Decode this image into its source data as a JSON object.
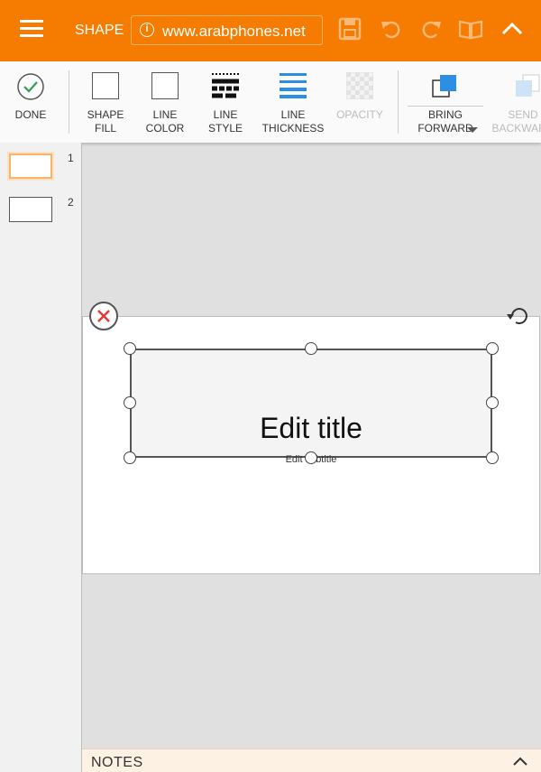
{
  "topbar": {
    "mode_label": "SHAPE",
    "url": "www.arabphones.net",
    "icons": [
      "menu-icon",
      "info-icon",
      "save-icon",
      "undo-icon",
      "redo-icon",
      "book-icon",
      "chevron-up-icon"
    ],
    "accent_color": "#f57c00"
  },
  "ribbon": {
    "done_label": "DONE",
    "shape_fill_label": "SHAPE\nFILL",
    "line_color_label": "LINE\nCOLOR",
    "line_style_label": "LINE\nSTYLE",
    "line_thickness_label": "LINE\nTHICKNESS",
    "opacity_label": "OPACITY",
    "bring_forward_label": "BRING\nFORWARD",
    "send_backward_label": "SEND\nBACKWARD"
  },
  "slides": {
    "thumbnails": [
      {
        "number": "1",
        "selected": true
      },
      {
        "number": "2",
        "selected": false
      }
    ]
  },
  "slide": {
    "title": "Edit title",
    "subtitle": "Edit subtitle"
  },
  "notes": {
    "label": "NOTES"
  }
}
